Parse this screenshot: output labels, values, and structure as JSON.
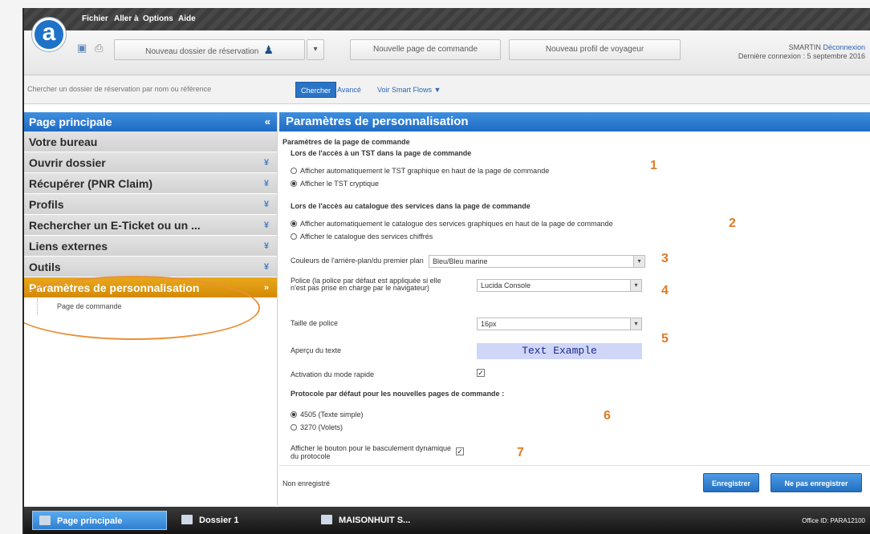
{
  "menubar": {
    "items": [
      "Fichier",
      "Aller à",
      "Options",
      "Aide"
    ]
  },
  "logo": {
    "letter": "a"
  },
  "toolbar": {
    "new_booking_label": "Nouveau dossier de réservation",
    "new_command_page_label": "Nouvelle page de commande",
    "new_traveler_profile_label": "Nouveau profil de voyageur"
  },
  "user": {
    "name": "SMARTIN",
    "logout": "Déconnexion",
    "last_login": "Dernière connexion : 5 septembre 2016"
  },
  "search": {
    "placeholder": "Chercher un dossier de réservation par nom ou référence",
    "button": "Chercher",
    "advanced": "Avancé",
    "smart_flows": "Voir Smart Flows ▼"
  },
  "sidebar": {
    "header": "Page principale",
    "collapse": "«",
    "items": [
      {
        "label": "Votre bureau",
        "chev": ""
      },
      {
        "label": "Ouvrir dossier",
        "chev": "¥"
      },
      {
        "label": "Récupérer (PNR Claim)",
        "chev": "¥"
      },
      {
        "label": "Profils",
        "chev": "¥"
      },
      {
        "label": "Rechercher un E-Ticket ou un ...",
        "chev": "¥"
      },
      {
        "label": "Liens externes",
        "chev": "¥"
      },
      {
        "label": "Outils",
        "chev": "¥"
      },
      {
        "label": "Paramètres de personnalisation",
        "chev": "»"
      }
    ],
    "sub_items": [
      "Page de commande"
    ]
  },
  "main": {
    "title": "Paramètres de personnalisation",
    "section_title": "Paramètres de la page de commande",
    "tst_heading": "Lors de l'accès à un TST dans la page de commande",
    "tst_options": [
      {
        "label": "Afficher automatiquement le TST graphique en haut de la page de commande",
        "selected": false
      },
      {
        "label": "Afficher le TST cryptique",
        "selected": true
      }
    ],
    "catalog_heading": "Lors de l'accès au catalogue des services dans la page de commande",
    "catalog_options": [
      {
        "label": "Afficher automatiquement le catalogue des services graphiques en haut de la page de commande",
        "selected": true
      },
      {
        "label": "Afficher le catalogue des services chiffrés",
        "selected": false
      }
    ],
    "bg_color_label": "Couleurs de l'arrière-plan/du premier plan",
    "bg_color_value": "Bleu/Bleu marine",
    "font_label": "Police (la police par défaut est appliquée si elle n'est pas prise en charge par le navigateur)",
    "font_value": "Lucida Console",
    "size_label": "Taille de police",
    "size_value": "16px",
    "preview_label": "Aperçu du texte",
    "preview_text": "Text Example",
    "quick_mode_label": "Activation du mode rapide",
    "quick_mode_checked": true,
    "protocol_heading": "Protocole par défaut pour les nouvelles pages de commande :",
    "protocol_options": [
      {
        "label": "4505 (Texte simple)",
        "selected": true
      },
      {
        "label": "3270 (Volets)",
        "selected": false
      }
    ],
    "toggle_label": "Afficher le bouton pour le basculement dynamique du protocole",
    "toggle_checked": true,
    "status": "Non enregistré",
    "save_button": "Enregistrer",
    "dont_save_button": "Ne pas enregistrer",
    "callouts": [
      "1",
      "2",
      "3",
      "4",
      "5",
      "6",
      "7"
    ]
  },
  "taskbar": {
    "tasks": [
      "Page principale",
      "Dossier 1",
      "MAISONHUIT S..."
    ],
    "office_id": "Office ID: PARA12100"
  },
  "colors": {
    "header_blue": "#1f6cc3",
    "active_orange": "#d38a05",
    "callout_orange": "#e07b26"
  }
}
